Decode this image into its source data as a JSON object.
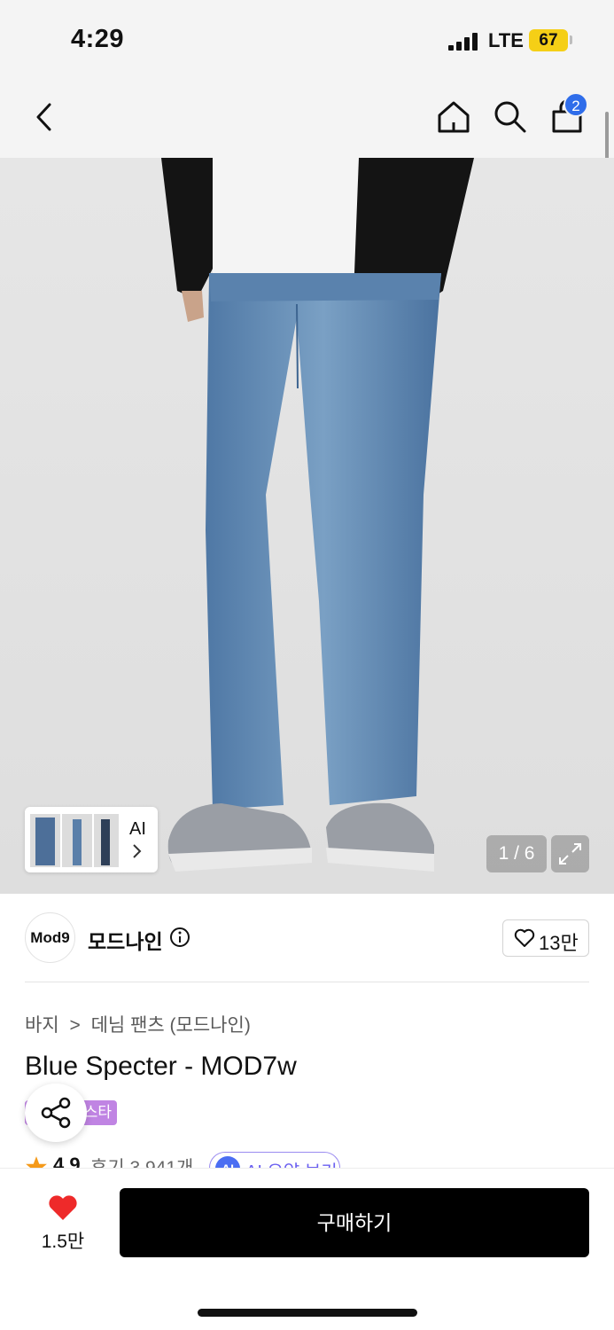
{
  "status_bar": {
    "time": "4:29",
    "network": "LTE",
    "battery": "67"
  },
  "nav": {
    "cart_count": "2",
    "icons": [
      "back-icon",
      "home-icon",
      "search-icon",
      "cart-icon"
    ]
  },
  "gallery": {
    "ai_label": "AI",
    "counter": "1 / 6"
  },
  "brand": {
    "logo_text": "Mod9",
    "name": "모드나인",
    "favorite_count": "13만"
  },
  "product": {
    "breadcrumb": [
      "바지",
      ">",
      "데님 팬츠 (모드나인)"
    ],
    "title": "Blue Specter - MOD7w",
    "tag": "스타",
    "rating": "4.9",
    "review_count": "후기 3,941개",
    "ai_summary": "AI 요약 보기"
  },
  "bottom_bar": {
    "like_count": "1.5만",
    "buy_label": "구매하기"
  },
  "colors": {
    "accent_blue": "#2f6dea",
    "heart_red": "#ee2a2a",
    "tag_purple": "#c084e3",
    "buy_black": "#000000",
    "battery_yellow": "#f5cf16"
  }
}
